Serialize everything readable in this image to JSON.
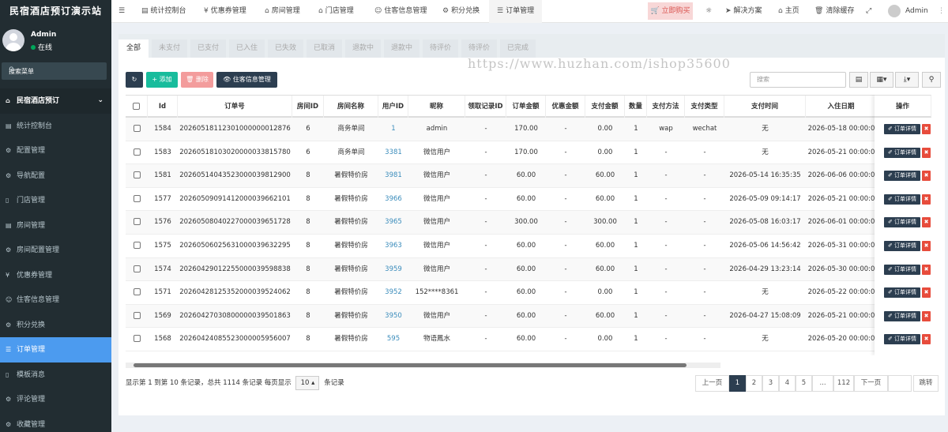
{
  "app": {
    "title": "民宿酒店预订演示站"
  },
  "user": {
    "name": "Admin",
    "status": "在线"
  },
  "sidebar": {
    "search_placeholder": "搜索菜单",
    "group": "民宿酒店预订",
    "items": [
      {
        "label": "统计控制台",
        "icon": "dashboard-icon"
      },
      {
        "label": "配置管理",
        "icon": "gear-icon"
      },
      {
        "label": "导航配置",
        "icon": "gear-icon"
      },
      {
        "label": "门店管理",
        "icon": "doc-icon"
      },
      {
        "label": "房间管理",
        "icon": "dashboard-icon"
      },
      {
        "label": "房间配置管理",
        "icon": "gear-icon"
      },
      {
        "label": "优惠券管理",
        "icon": "yen-icon"
      },
      {
        "label": "住客信息管理",
        "icon": "users-icon"
      },
      {
        "label": "积分兑换",
        "icon": "gear-icon"
      },
      {
        "label": "订单管理",
        "icon": "list-icon",
        "active": true
      },
      {
        "label": "模板消息",
        "icon": "doc-icon"
      },
      {
        "label": "评论管理",
        "icon": "gear-icon"
      },
      {
        "label": "收藏管理",
        "icon": "gear-icon"
      }
    ]
  },
  "topbar": {
    "tabs": [
      {
        "label": "统计控制台",
        "icon": "chart-icon"
      },
      {
        "label": "优惠券管理",
        "icon": "yen-icon"
      },
      {
        "label": "房间管理",
        "icon": "home-icon"
      },
      {
        "label": "门店管理",
        "icon": "bank-icon"
      },
      {
        "label": "住客信息管理",
        "icon": "users-icon"
      },
      {
        "label": "积分兑换",
        "icon": "gear-icon"
      },
      {
        "label": "订单管理",
        "icon": "list-icon",
        "active": true
      }
    ],
    "buy": "立即购买",
    "solution": "解决方案",
    "home": "主页",
    "clear_cache": "清除缓存",
    "admin": "Admin"
  },
  "filter_tabs": [
    "全部",
    "未支付",
    "已支付",
    "已入住",
    "已失效",
    "已取消",
    "退款中",
    "退款中",
    "待评价",
    "待评价",
    "已完成"
  ],
  "toolbar": {
    "add": "添加",
    "delete": "删除",
    "guest": "住客信息管理",
    "search_placeholder": "搜索"
  },
  "watermark": "https://www.huzhan.com/ishop35600",
  "columns": [
    "Id",
    "订单号",
    "房间ID",
    "房间名称",
    "用户ID",
    "昵称",
    "领取记录ID",
    "订单金额",
    "优惠金额",
    "支付金额",
    "数量",
    "支付方法",
    "支付类型",
    "支付时间",
    "入住日期",
    "操作"
  ],
  "rows": [
    {
      "id": "1584",
      "order": "20260518112301000000012876",
      "room_id": "6",
      "room": "商务单间",
      "uid": "1",
      "nick": "admin",
      "coupon": "-",
      "amount": "170.00",
      "discount": "-",
      "paid": "0.00",
      "qty": "1",
      "method": "wap",
      "type": "wechat",
      "pay_time": "无",
      "checkin": "2026-05-18 00:00:0"
    },
    {
      "id": "1583",
      "order": "20260518103020000033815780",
      "room_id": "6",
      "room": "商务单间",
      "uid": "3381",
      "nick": "微信用户",
      "coupon": "-",
      "amount": "170.00",
      "discount": "-",
      "paid": "0.00",
      "qty": "1",
      "method": "-",
      "type": "-",
      "pay_time": "无",
      "checkin": "2026-05-21 00:00:0"
    },
    {
      "id": "1581",
      "order": "20260514043523000039812900",
      "room_id": "8",
      "room": "暑假特价房",
      "uid": "3981",
      "nick": "微信用户",
      "coupon": "-",
      "amount": "60.00",
      "discount": "-",
      "paid": "60.00",
      "qty": "1",
      "method": "-",
      "type": "-",
      "pay_time": "2026-05-14 16:35:35",
      "checkin": "2026-06-06 00:00:0"
    },
    {
      "id": "1577",
      "order": "20260509091412000039662101",
      "room_id": "8",
      "room": "暑假特价房",
      "uid": "3966",
      "nick": "微信用户",
      "coupon": "-",
      "amount": "60.00",
      "discount": "-",
      "paid": "60.00",
      "qty": "1",
      "method": "-",
      "type": "-",
      "pay_time": "2026-05-09 09:14:17",
      "checkin": "2026-05-21 00:00:0"
    },
    {
      "id": "1576",
      "order": "20260508040227000039651728",
      "room_id": "8",
      "room": "暑假特价房",
      "uid": "3965",
      "nick": "微信用户",
      "coupon": "-",
      "amount": "300.00",
      "discount": "-",
      "paid": "300.00",
      "qty": "1",
      "method": "-",
      "type": "-",
      "pay_time": "2026-05-08 16:03:17",
      "checkin": "2026-06-01 00:00:0"
    },
    {
      "id": "1575",
      "order": "20260506025631000039632295",
      "room_id": "8",
      "room": "暑假特价房",
      "uid": "3963",
      "nick": "微信用户",
      "coupon": "-",
      "amount": "60.00",
      "discount": "-",
      "paid": "60.00",
      "qty": "1",
      "method": "-",
      "type": "-",
      "pay_time": "2026-05-06 14:56:42",
      "checkin": "2026-05-31 00:00:0"
    },
    {
      "id": "1574",
      "order": "20260429012255000039598838",
      "room_id": "8",
      "room": "暑假特价房",
      "uid": "3959",
      "nick": "微信用户",
      "coupon": "-",
      "amount": "60.00",
      "discount": "-",
      "paid": "60.00",
      "qty": "1",
      "method": "-",
      "type": "-",
      "pay_time": "2026-04-29 13:23:14",
      "checkin": "2026-05-30 00:00:0"
    },
    {
      "id": "1571",
      "order": "20260428125352000039524062",
      "room_id": "8",
      "room": "暑假特价房",
      "uid": "3952",
      "nick": "152****8361",
      "coupon": "-",
      "amount": "60.00",
      "discount": "-",
      "paid": "0.00",
      "qty": "1",
      "method": "-",
      "type": "-",
      "pay_time": "无",
      "checkin": "2026-05-22 00:00:0"
    },
    {
      "id": "1569",
      "order": "20260427030800000039501863",
      "room_id": "8",
      "room": "暑假特价房",
      "uid": "3950",
      "nick": "微信用户",
      "coupon": "-",
      "amount": "60.00",
      "discount": "-",
      "paid": "60.00",
      "qty": "1",
      "method": "-",
      "type": "-",
      "pay_time": "2026-04-27 15:08:09",
      "checkin": "2026-05-21 00:00:0"
    },
    {
      "id": "1568",
      "order": "20260424085523000005956007",
      "room_id": "8",
      "room": "暑假特价房",
      "uid": "595",
      "nick": "物语鳳水",
      "coupon": "-",
      "amount": "60.00",
      "discount": "-",
      "paid": "0.00",
      "qty": "1",
      "method": "-",
      "type": "-",
      "pay_time": "无",
      "checkin": "2026-05-20 00:00:0"
    }
  ],
  "row_actions": {
    "detail": "订单详情"
  },
  "footer": {
    "prefix": "显示第 1 到第 10 条记录，总共 1114 条记录 每页显示",
    "page_size": "10",
    "suffix": "条记录"
  },
  "pagination": {
    "prev": "上一页",
    "pages": [
      "1",
      "2",
      "3",
      "4",
      "5",
      "...",
      "112"
    ],
    "next": "下一页",
    "jump": "跳转"
  }
}
